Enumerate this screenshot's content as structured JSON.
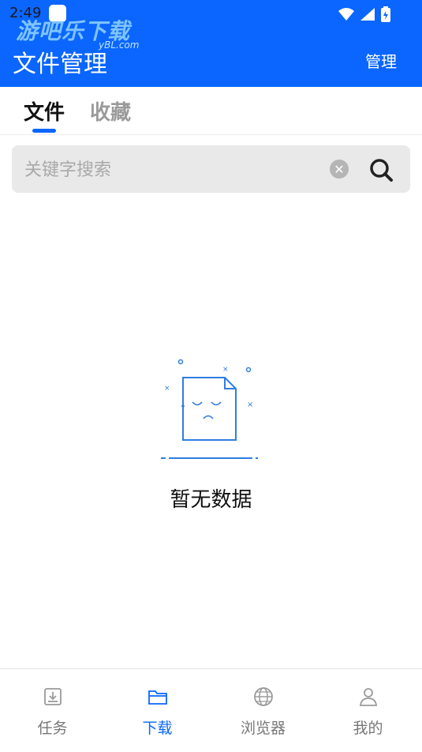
{
  "status_bar": {
    "time": "2:49",
    "watermark": "游吧乐下载",
    "watermark_sub": "yBL.com"
  },
  "header": {
    "title": "文件管理",
    "manage_label": "管理"
  },
  "tabs": [
    {
      "label": "文件",
      "active": true
    },
    {
      "label": "收藏",
      "active": false
    }
  ],
  "search": {
    "placeholder": "关键字搜索",
    "value": ""
  },
  "empty_state": {
    "message": "暂无数据"
  },
  "bottom_nav": [
    {
      "label": "任务",
      "icon": "download-tray-icon",
      "active": false
    },
    {
      "label": "下载",
      "icon": "folder-icon",
      "active": true
    },
    {
      "label": "浏览器",
      "icon": "globe-icon",
      "active": false
    },
    {
      "label": "我的",
      "icon": "profile-icon",
      "active": false
    }
  ],
  "colors": {
    "accent": "#0a66ff",
    "inactive_text": "#777777"
  }
}
